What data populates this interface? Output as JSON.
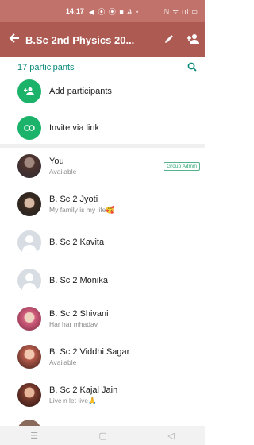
{
  "statusbar": {
    "time": "14:17",
    "notifications": "◀ ⦿ ⦿ ■ 𝘈 •",
    "right_icons": "ℕ ᯤ ııl ▭"
  },
  "header": {
    "title": "B.Sc 2nd Physics 20...",
    "back_icon": "back-arrow-icon",
    "edit_icon": "pencil-icon",
    "add_icon": "add-person-icon"
  },
  "participants": {
    "count_label": "17 participants",
    "search_icon": "search-icon"
  },
  "actions": [
    {
      "label": "Add participants",
      "icon": "add-person-icon"
    },
    {
      "label": "Invite via link",
      "icon": "link-icon"
    }
  ],
  "members": [
    {
      "name": "You",
      "status": "Available",
      "badge": "Group Admin"
    },
    {
      "name": "B. Sc 2 Jyoti",
      "status": "My family is my life🥰",
      "badge": ""
    },
    {
      "name": "B. Sc 2 Kavita",
      "status": "",
      "badge": ""
    },
    {
      "name": "B. Sc 2 Monika",
      "status": "",
      "badge": ""
    },
    {
      "name": "B. Sc 2 Shivani",
      "status": "Har har mhadav",
      "badge": ""
    },
    {
      "name": "B. Sc 2 Viddhi Sagar",
      "status": "Available",
      "badge": ""
    },
    {
      "name": "B. Sc 2 Kajal Jain",
      "status": "Live n let live🙏",
      "badge": ""
    }
  ],
  "navbar": {
    "menu_icon": "☰",
    "home_icon": "▢",
    "back_icon": "◁"
  }
}
